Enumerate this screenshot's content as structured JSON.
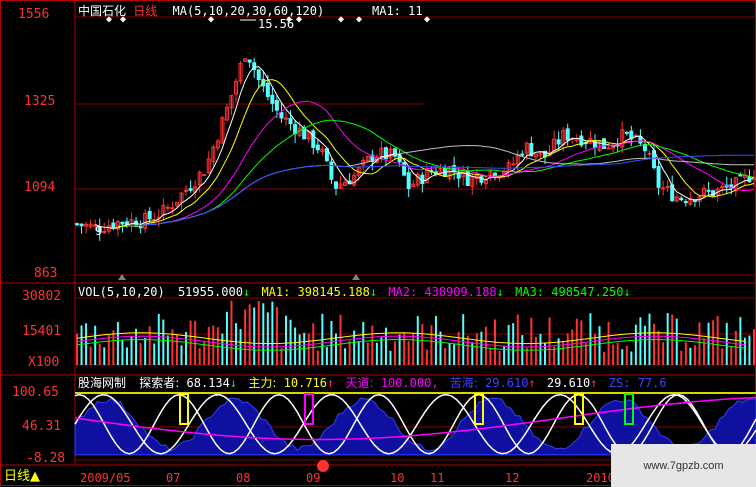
{
  "header": {
    "stock_name": "中国石化",
    "period": "日线",
    "ma_params": "MA(5,10,20,30,60,120)",
    "ma1_label": "MA1: 11",
    "peak_label": "15.56",
    "low_marker": "9"
  },
  "price_axis": {
    "ticks": [
      "1556",
      "1325",
      "1094",
      "863"
    ]
  },
  "vol_panel": {
    "title": "VOL(5,10,20)",
    "value": "51955.000",
    "ma1": "MA1: 398145.188",
    "ma2": "MA2: 438909.188",
    "ma3": "MA3: 498547.250",
    "ticks": [
      "30802",
      "15401",
      "X100"
    ]
  },
  "ind_panel": {
    "name": "股海网制",
    "items": [
      {
        "label": "探索者:",
        "value": "68.134",
        "color": "#ffffff"
      },
      {
        "label": "主力:",
        "value": "10.716",
        "color": "#ffff00"
      },
      {
        "label": "天道:",
        "value": "100.000",
        "color": "#ff00ff"
      },
      {
        "label": "苦海:",
        "value": "29.610",
        "color": "#4040ff"
      },
      {
        "label": "",
        "value": "29.610",
        "color": "#ffffff"
      },
      {
        "label": "ZS:",
        "value": "77.6",
        "color": "#4040ff"
      }
    ],
    "ticks": [
      "100.65",
      "46.31",
      "-8.28"
    ]
  },
  "time_axis": {
    "period_button": "日线",
    "labels": [
      "2009/05",
      "07",
      "08",
      "09",
      "10",
      "11",
      "12",
      "2010"
    ]
  },
  "watermark": "www.7gpzb.com",
  "colors": {
    "up": "#ff3232",
    "down": "#54ffff",
    "axis": "#b40000",
    "ma5": "#ffffff",
    "ma10": "#ffff00",
    "ma20": "#ff00ff",
    "ma30": "#00ff00",
    "ma60": "#c0c0c0",
    "ma120": "#3050ff"
  },
  "chart_data": {
    "type": "candlestick",
    "ylim": [
      863,
      1556
    ],
    "peak": 15.56,
    "price_path": [
      [
        0,
        1000
      ],
      [
        0.03,
        990
      ],
      [
        0.06,
        1005
      ],
      [
        0.1,
        1010
      ],
      [
        0.13,
        1035
      ],
      [
        0.16,
        1090
      ],
      [
        0.19,
        1150
      ],
      [
        0.22,
        1300
      ],
      [
        0.25,
        1470
      ],
      [
        0.27,
        1380
      ],
      [
        0.3,
        1290
      ],
      [
        0.33,
        1250
      ],
      [
        0.36,
        1200
      ],
      [
        0.38,
        1100
      ],
      [
        0.41,
        1130
      ],
      [
        0.44,
        1190
      ],
      [
        0.47,
        1180
      ],
      [
        0.49,
        1100
      ],
      [
        0.52,
        1140
      ],
      [
        0.55,
        1150
      ],
      [
        0.58,
        1120
      ],
      [
        0.61,
        1140
      ],
      [
        0.64,
        1150
      ],
      [
        0.66,
        1210
      ],
      [
        0.69,
        1180
      ],
      [
        0.72,
        1240
      ],
      [
        0.75,
        1230
      ],
      [
        0.78,
        1210
      ],
      [
        0.81,
        1240
      ],
      [
        0.84,
        1200
      ],
      [
        0.86,
        1100
      ],
      [
        0.89,
        1070
      ],
      [
        0.92,
        1080
      ],
      [
        0.95,
        1090
      ],
      [
        0.98,
        1110
      ],
      [
        1,
        1140
      ]
    ],
    "volume_level": 15401,
    "volume_range": [
      0,
      30802
    ],
    "indicator_range": [
      -8.28,
      100.65
    ]
  }
}
